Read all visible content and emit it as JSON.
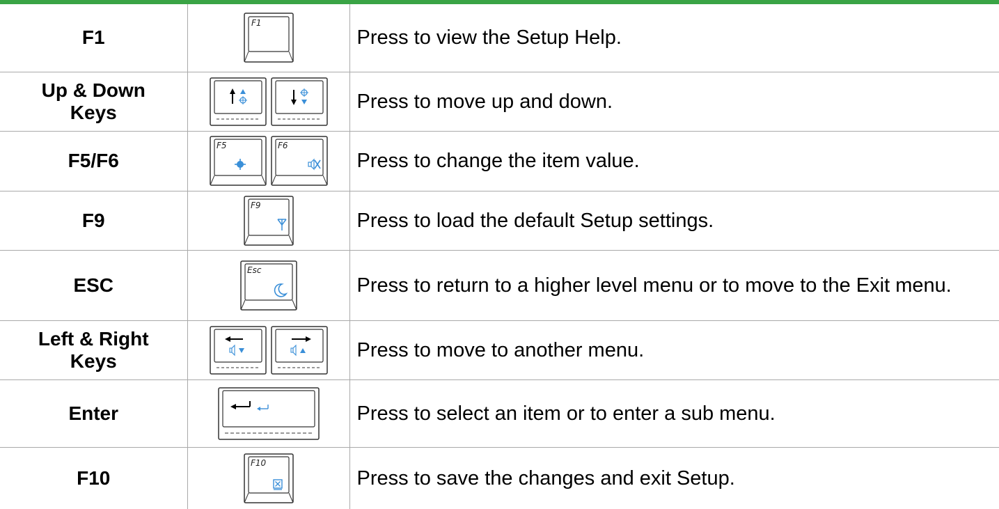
{
  "colors": {
    "accent_bar": "#3aa445",
    "icon_blue": "#3a8fd8",
    "grid": "#a9a9a9"
  },
  "rows": [
    {
      "name": "F1",
      "description": "Press to view the Setup Help.",
      "keys": [
        {
          "label": "F1",
          "icon": ""
        }
      ]
    },
    {
      "name": "Up & Down\nKeys",
      "description": "Press to move up and down.",
      "keys": [
        {
          "label": "",
          "icon": "up-arrow-brightness-icon"
        },
        {
          "label": "",
          "icon": "down-arrow-brightness-icon"
        }
      ]
    },
    {
      "name": "F5/F6",
      "description": "Press to change the item value.",
      "keys": [
        {
          "label": "F5",
          "icon": "brightness-icon"
        },
        {
          "label": "F6",
          "icon": "mute-icon"
        }
      ]
    },
    {
      "name": "F9",
      "description": "Press to load the default Setup settings.",
      "keys": [
        {
          "label": "F9",
          "icon": "wireless-icon"
        }
      ]
    },
    {
      "name": "ESC",
      "description": "Press to return to a higher level menu or to move to the Exit menu.",
      "keys": [
        {
          "label": "Esc",
          "icon": "sleep-moon-icon"
        }
      ]
    },
    {
      "name": "Left & Right\nKeys",
      "description": "Press to move to another menu.",
      "keys": [
        {
          "label": "",
          "icon": "left-arrow-volume-down-icon"
        },
        {
          "label": "",
          "icon": "right-arrow-volume-up-icon"
        }
      ]
    },
    {
      "name": "Enter",
      "description": "Press to select an item or to enter a sub menu.",
      "keys": [
        {
          "label": "",
          "icon": "enter-icon"
        }
      ]
    },
    {
      "name": "F10",
      "description": "Press to save the changes and exit Setup.",
      "keys": [
        {
          "label": "F10",
          "icon": "close-box-icon"
        }
      ]
    }
  ]
}
